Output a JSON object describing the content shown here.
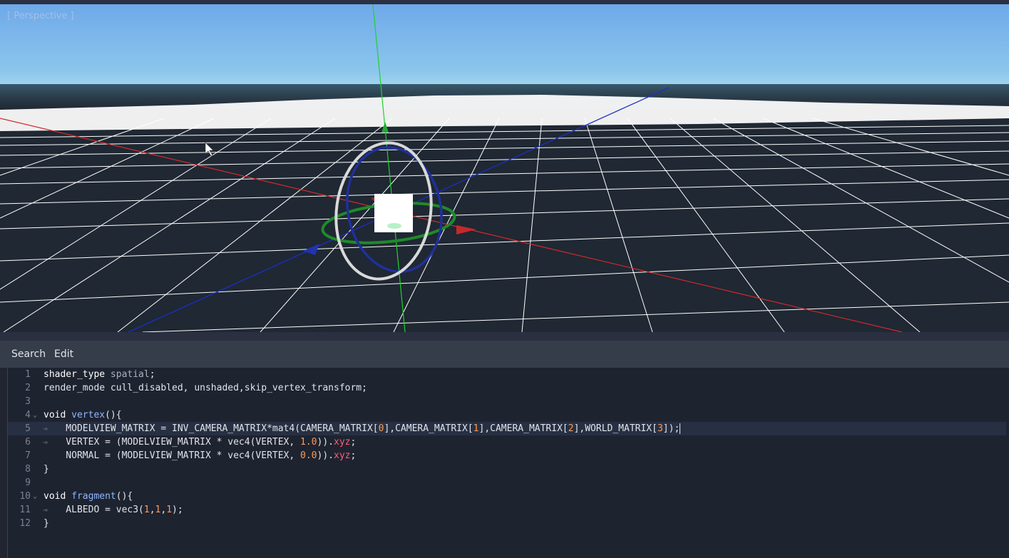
{
  "viewport": {
    "label": "[ Perspective ]",
    "colors": {
      "sky_top": "#6ea9ea",
      "sky_horizon": "#a7d8ee",
      "floor": "#1f2833",
      "grid": "#ffffff",
      "x_axis": "#d6282a",
      "y_axis": "#22d12b",
      "z_axis": "#1c2fc4"
    }
  },
  "menu": {
    "search": "Search",
    "edit": "Edit"
  },
  "editor": {
    "lines": [
      {
        "n": "1",
        "parts": [
          {
            "t": "shader_type ",
            "c": "kw"
          },
          {
            "t": "spatial",
            "c": "dim"
          },
          {
            "t": ";",
            "c": "p"
          }
        ]
      },
      {
        "n": "2",
        "parts": [
          {
            "t": "render_mode cull_disabled, unshaded,skip_vertex_transform;",
            "c": "p"
          }
        ]
      },
      {
        "n": "3",
        "parts": []
      },
      {
        "n": "4",
        "fold": "⌄",
        "parts": [
          {
            "t": "void ",
            "c": "kw"
          },
          {
            "t": "vertex",
            "c": "fn"
          },
          {
            "t": "(){",
            "c": "p"
          }
        ]
      },
      {
        "n": "5",
        "tab": "⇥",
        "current": true,
        "caret": true,
        "parts": [
          {
            "t": "    MODELVIEW_MATRIX = INV_CAMERA_MATRIX*mat4(CAMERA_MATRIX[",
            "c": "p"
          },
          {
            "t": "0",
            "c": "num"
          },
          {
            "t": "],CAMERA_MATRIX[",
            "c": "p"
          },
          {
            "t": "1",
            "c": "num"
          },
          {
            "t": "],CAMERA_MATRIX[",
            "c": "p"
          },
          {
            "t": "2",
            "c": "num"
          },
          {
            "t": "],WORLD_MATRIX[",
            "c": "p"
          },
          {
            "t": "3",
            "c": "num"
          },
          {
            "t": "]);",
            "c": "p"
          }
        ]
      },
      {
        "n": "6",
        "tab": "⇥",
        "parts": [
          {
            "t": "    VERTEX = (MODELVIEW_MATRIX * vec4(VERTEX, ",
            "c": "p"
          },
          {
            "t": "1.0",
            "c": "num"
          },
          {
            "t": ")).",
            "c": "p"
          },
          {
            "t": "xyz",
            "c": "sw"
          },
          {
            "t": ";",
            "c": "p"
          }
        ]
      },
      {
        "n": "7",
        "parts": [
          {
            "t": "    NORMAL = (MODELVIEW_MATRIX * vec4(VERTEX, ",
            "c": "p"
          },
          {
            "t": "0.0",
            "c": "num"
          },
          {
            "t": ")).",
            "c": "p"
          },
          {
            "t": "xyz",
            "c": "sw"
          },
          {
            "t": ";",
            "c": "p"
          }
        ]
      },
      {
        "n": "8",
        "parts": [
          {
            "t": "}",
            "c": "p"
          }
        ]
      },
      {
        "n": "9",
        "parts": []
      },
      {
        "n": "10",
        "fold": "⌄",
        "parts": [
          {
            "t": "void ",
            "c": "kw"
          },
          {
            "t": "fragment",
            "c": "fn"
          },
          {
            "t": "(){",
            "c": "p"
          }
        ]
      },
      {
        "n": "11",
        "tab": "⇥",
        "parts": [
          {
            "t": "    ALBEDO = vec3(",
            "c": "p"
          },
          {
            "t": "1",
            "c": "num"
          },
          {
            "t": ",",
            "c": "p"
          },
          {
            "t": "1",
            "c": "num"
          },
          {
            "t": ",",
            "c": "p"
          },
          {
            "t": "1",
            "c": "num"
          },
          {
            "t": ");",
            "c": "p"
          }
        ]
      },
      {
        "n": "12",
        "parts": [
          {
            "t": "}",
            "c": "p"
          }
        ]
      }
    ]
  }
}
